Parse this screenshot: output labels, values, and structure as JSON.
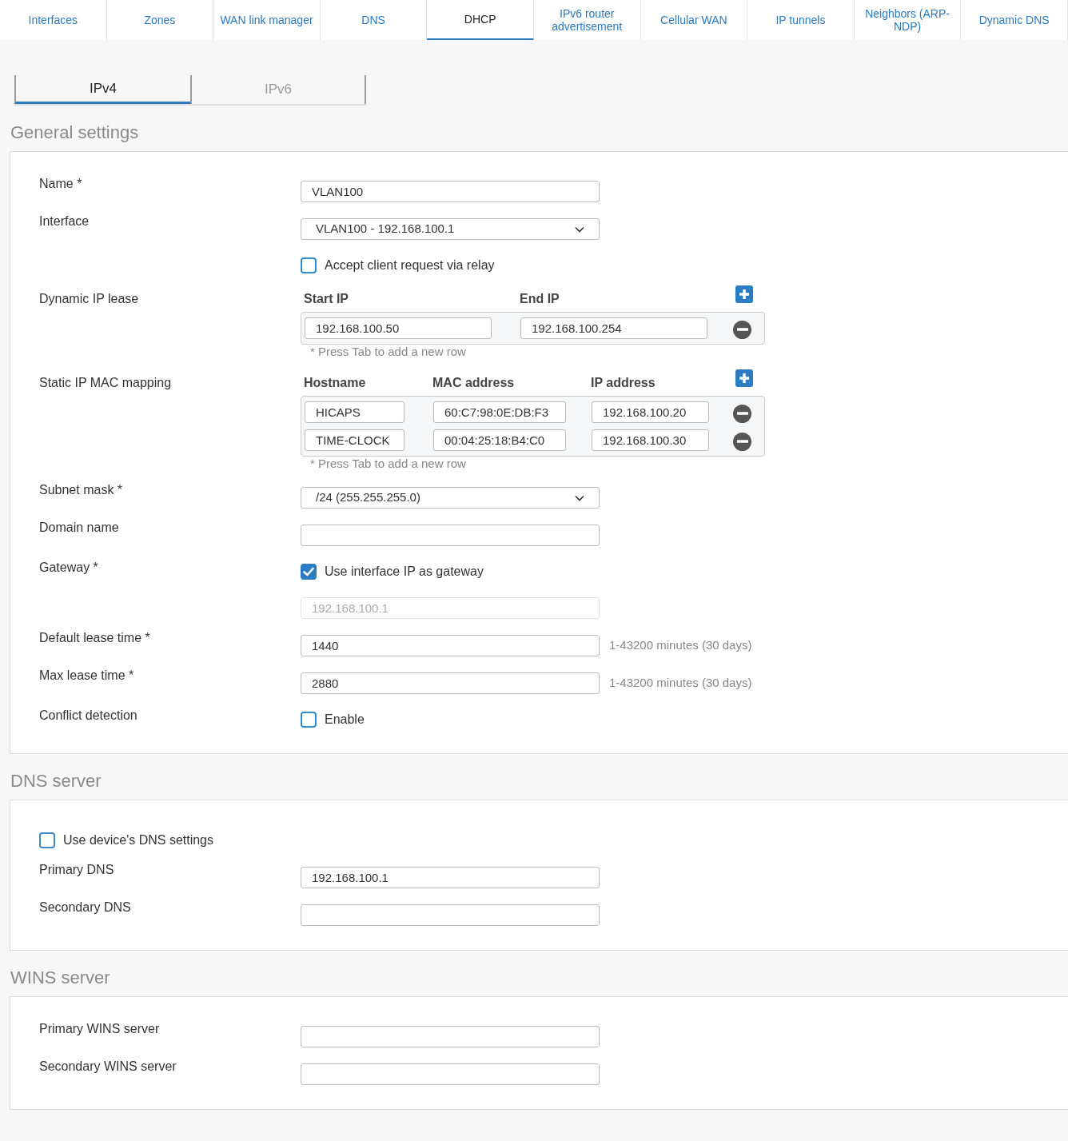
{
  "top_tabs": [
    {
      "label": "Interfaces",
      "selected": false
    },
    {
      "label": "Zones",
      "selected": false
    },
    {
      "label": "WAN link manager",
      "selected": false
    },
    {
      "label": "DNS",
      "selected": false
    },
    {
      "label": "DHCP",
      "selected": true
    },
    {
      "label": "IPv6 router advertisement",
      "selected": false
    },
    {
      "label": "Cellular WAN",
      "selected": false
    },
    {
      "label": "IP tunnels",
      "selected": false
    },
    {
      "label": "Neighbors (ARP-NDP)",
      "selected": false
    },
    {
      "label": "Dynamic DNS",
      "selected": false
    }
  ],
  "sub_tabs": [
    {
      "label": "IPv4",
      "selected": true
    },
    {
      "label": "IPv6",
      "selected": false
    }
  ],
  "sections": [
    {
      "title": "General settings",
      "rows": [
        {
          "kind": "input",
          "label": "Name *",
          "value": "VLAN100"
        },
        {
          "kind": "select",
          "label": "Interface",
          "value": "VLAN100 - 192.168.100.1"
        },
        {
          "kind": "checkbox",
          "text": "Accept client request via relay",
          "checked": false
        },
        {
          "kind": "table",
          "label": "Dynamic IP lease",
          "columns": [
            "Start IP",
            "End IP"
          ],
          "rows": [
            [
              "192.168.100.50",
              "192.168.100.254"
            ]
          ],
          "note": "* Press Tab to add a new row"
        },
        {
          "kind": "table",
          "label": "Static IP MAC mapping",
          "columns": [
            "Hostname",
            "MAC address",
            "IP address"
          ],
          "rows": [
            [
              "HICAPS",
              "60:C7:98:0E:DB:F3",
              "192.168.100.20"
            ],
            [
              "TIME-CLOCK",
              "00:04:25:18:B4:C0",
              "192.168.100.30"
            ]
          ],
          "note": "* Press Tab to add a new row"
        },
        {
          "kind": "select",
          "label": "Subnet mask *",
          "value": "/24 (255.255.255.0)"
        },
        {
          "kind": "input",
          "label": "Domain name"
        },
        {
          "kind": "checkbox",
          "label": "Gateway *",
          "text": "Use interface IP as gateway",
          "checked": true
        },
        {
          "kind": "input",
          "value": "192.168.100.1",
          "disabled": true
        },
        {
          "kind": "input",
          "label": "Default lease time *",
          "value": "1440",
          "hint": "1-43200 minutes (30 days)"
        },
        {
          "kind": "input",
          "label": "Max lease time *",
          "value": "2880",
          "hint": "1-43200 minutes (30 days)"
        },
        {
          "kind": "checkbox",
          "label": "Conflict detection",
          "text": "Enable",
          "checked": false
        }
      ]
    },
    {
      "title": "DNS server",
      "rows": [
        {
          "kind": "wide_checkbox",
          "text": "Use device's DNS settings",
          "checked": false
        },
        {
          "kind": "input",
          "label": "Primary DNS",
          "value": "192.168.100.1"
        },
        {
          "kind": "input",
          "label": "Secondary DNS"
        }
      ]
    },
    {
      "title": "WINS server",
      "rows": [
        {
          "kind": "input",
          "label": "Primary WINS server"
        },
        {
          "kind": "input",
          "label": "Secondary WINS server"
        }
      ]
    }
  ]
}
